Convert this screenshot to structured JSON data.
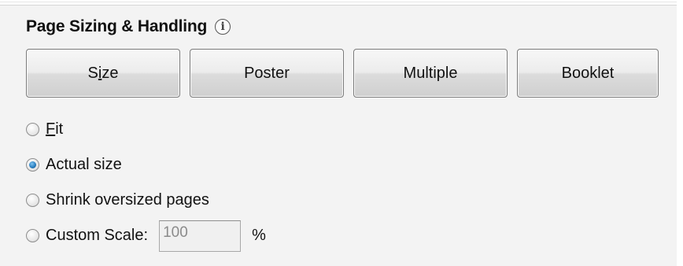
{
  "section": {
    "title": "Page Sizing & Handling",
    "info_icon": "info-icon",
    "info_glyph": "i"
  },
  "buttons": [
    {
      "label_pre": "S",
      "label_mnemonic": "i",
      "label_post": "ze"
    },
    {
      "label": "Poster"
    },
    {
      "label": "Multiple"
    },
    {
      "label": "Booklet"
    }
  ],
  "options": [
    {
      "label_mnemonic": "F",
      "label_post": "it",
      "checked": false
    },
    {
      "label": "Actual size",
      "checked": true
    },
    {
      "label": "Shrink oversized pages",
      "checked": false
    },
    {
      "label": "Custom Scale:",
      "checked": false
    }
  ],
  "custom_scale": {
    "value": "100",
    "unit": "%",
    "disabled": true
  },
  "colors": {
    "panel_bg": "#f3f3f3",
    "radio_selected": "#2a7fc0",
    "disabled_text": "#8b8b8b"
  }
}
